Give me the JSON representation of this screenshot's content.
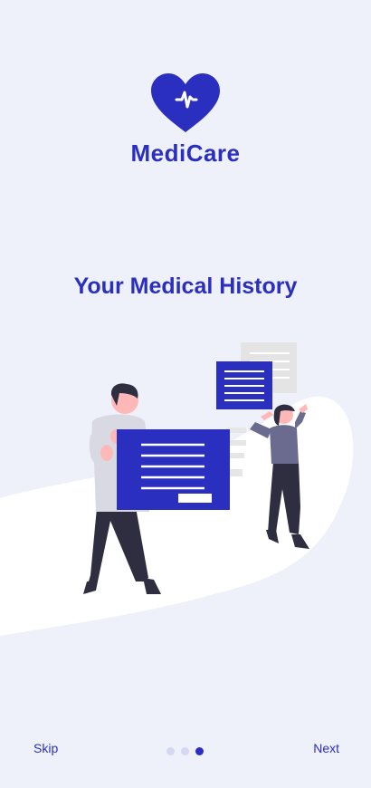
{
  "app": {
    "name": "MediCare",
    "brand_color": "#2b2fbf"
  },
  "onboarding": {
    "headline": "Your Medical History",
    "current_page": 3,
    "total_pages": 3
  },
  "footer": {
    "skip_label": "Skip",
    "next_label": "Next"
  },
  "icons": {
    "logo": "heart-pulse-icon"
  }
}
